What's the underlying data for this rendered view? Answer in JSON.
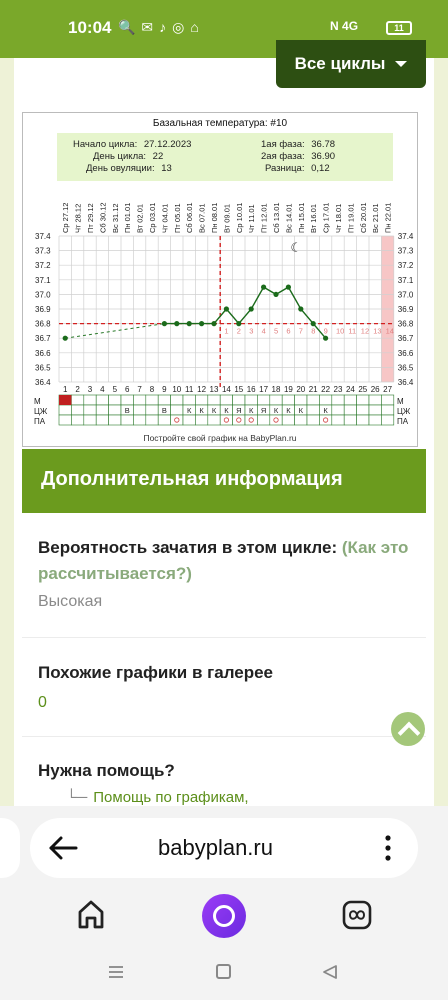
{
  "status": {
    "time": "10:04",
    "network": "4G",
    "battery": "11"
  },
  "header": {
    "cycles_button": "Все циклы"
  },
  "chart": {
    "title": "Базальная температура: #10",
    "summary": {
      "cycle_start_label": "Начало цикла:",
      "cycle_start": "27.12.2023",
      "cycle_day_label": "День цикла:",
      "cycle_day": "22",
      "ovulation_day_label": "День овуляции:",
      "ovulation_day": "13",
      "phase1_label": "1ая фаза:",
      "phase1": "36.78",
      "phase2_label": "2ая фаза:",
      "phase2": "36.90",
      "diff_label": "Разница:",
      "diff": "0,12"
    },
    "footer": "Постройте свой график на BabyPlan.ru",
    "row_labels": [
      "М",
      "ЦЖ",
      "ПА"
    ]
  },
  "chart_data": {
    "type": "line",
    "title": "Базальная температура: #10",
    "ylim": [
      36.4,
      37.4
    ],
    "yticks": [
      "37.4",
      "37.3",
      "37.2",
      "37.1",
      "37.0",
      "36.9",
      "36.8",
      "36.7",
      "36.6",
      "36.5",
      "36.4"
    ],
    "x_days": [
      "1",
      "2",
      "3",
      "4",
      "5",
      "6",
      "7",
      "8",
      "9",
      "10",
      "11",
      "12",
      "13",
      "14",
      "15",
      "16",
      "17",
      "18",
      "19",
      "20",
      "21",
      "22",
      "23",
      "24",
      "25",
      "26",
      "27"
    ],
    "x_dates": [
      "Ср 27.12",
      "Чт 28.12",
      "Пт 29.12",
      "Сб 30.12",
      "Вс 31.12",
      "Пн 01.01",
      "Вт 02.01",
      "Ср 03.01",
      "Чт 04.01",
      "Пт 05.01",
      "Сб 06.01",
      "Вс 07.01",
      "Пн 08.01",
      "Вт 09.01",
      "Ср 10.01",
      "Чт 11.01",
      "Пт 12.01",
      "Сб 13.01",
      "Вс 14.01",
      "Пн 15.01",
      "Вт 16.01",
      "Ср 17.01",
      "Чт 18.01",
      "Пт 19.01",
      "Сб 20.01",
      "Вс 21.01",
      "Пн 22.01"
    ],
    "series": [
      {
        "points": [
          [
            1,
            36.7
          ],
          [
            9,
            36.8
          ],
          [
            10,
            36.8
          ],
          [
            11,
            36.8
          ],
          [
            12,
            36.8
          ],
          [
            13,
            36.8
          ],
          [
            14,
            36.9
          ],
          [
            15,
            36.8
          ],
          [
            16,
            36.9
          ],
          [
            17,
            37.05
          ],
          [
            18,
            37.0
          ],
          [
            19,
            37.05
          ],
          [
            20,
            36.9
          ],
          [
            21,
            36.8
          ],
          [
            22,
            36.7
          ]
        ]
      }
    ],
    "coverline": 36.8,
    "ovulation_day": 13,
    "luteal_day_labels": [
      "1",
      "2",
      "3",
      "4",
      "5",
      "6",
      "7",
      "8",
      "9",
      "10",
      "11",
      "12",
      "13",
      "14"
    ],
    "mens_row": {
      "1": "M"
    },
    "cz_row": {
      "6": "В",
      "9": "В",
      "11": "К",
      "12": "К",
      "13": "К",
      "14": "К",
      "15": "Я",
      "16": "К",
      "17": "Я",
      "18": "К",
      "19": "К",
      "20": "К",
      "22": "К"
    },
    "pa_row_days": [
      10,
      14,
      15,
      16,
      18,
      22
    ],
    "current_day": 22,
    "grid": true
  },
  "info": {
    "header": "Дополнительная информация",
    "conception_title": "Вероятность зачатия в этом цикле:",
    "conception_link": "(Как это рассчитывается?)",
    "conception_value": "Высокая",
    "similar_title": "Похожие графики в галерее",
    "similar_value": "0",
    "help_title": "Нужна помощь?",
    "help_link": "Помощь по графикам,"
  },
  "browser": {
    "url": "babyplan.ru"
  }
}
